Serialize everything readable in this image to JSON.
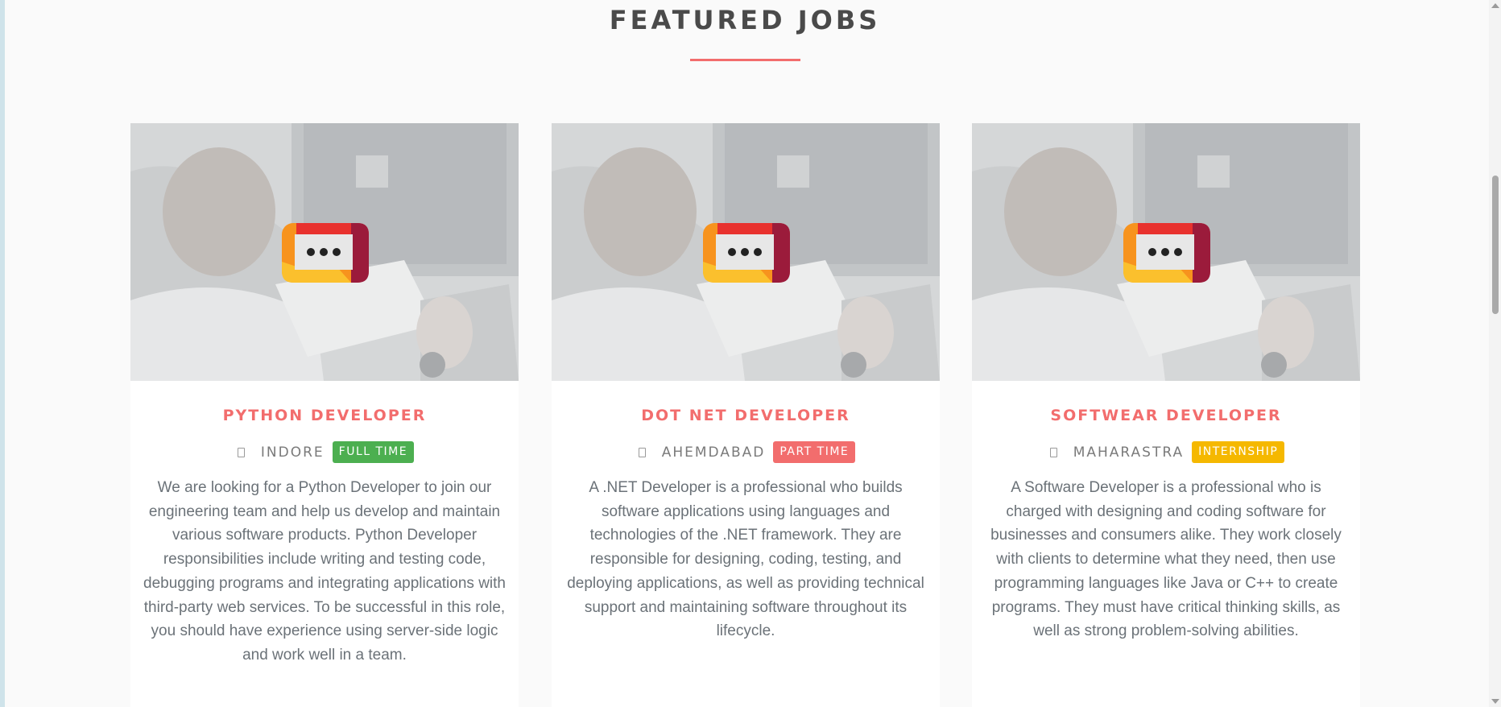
{
  "section": {
    "title": "FEATURED JOBS"
  },
  "colors": {
    "accent": "#f26d6d",
    "full_time": "#4caf50",
    "part_time": "#f26d6d",
    "internship": "#f5b800"
  },
  "jobs": [
    {
      "title": "PYTHON DEVELOPER",
      "location_icon": "location-icon",
      "location": "INDORE",
      "type": "FULL TIME",
      "type_color": "#4caf50",
      "description": "We are looking for a Python Developer to join our engineering team and help us develop and maintain various software products. Python Developer responsibilities include writing and testing code, debugging programs and integrating applications with third-party web services. To be successful in this role, you should have experience using server-side logic and work well in a team."
    },
    {
      "title": "DOT NET DEVELOPER",
      "location_icon": "location-icon",
      "location": "AHEMDABAD",
      "type": "PART TIME",
      "type_color": "#f26d6d",
      "description": "A .NET Developer is a professional who builds software applications using languages and technologies of the .NET framework. They are responsible for designing, coding, testing, and deploying applications, as well as providing technical support and maintaining software throughout its lifecycle."
    },
    {
      "title": "SOFTWEAR DEVELOPER",
      "location_icon": "location-icon",
      "location": "MAHARASTRA",
      "type": "INTERNSHIP",
      "type_color": "#f5b800",
      "description": "A Software Developer is a professional who is charged with designing and coding software for businesses and consumers alike. They work closely with clients to determine what they need, then use programming languages like Java or C++ to create programs. They must have critical thinking skills, as well as strong problem-solving abilities."
    }
  ]
}
